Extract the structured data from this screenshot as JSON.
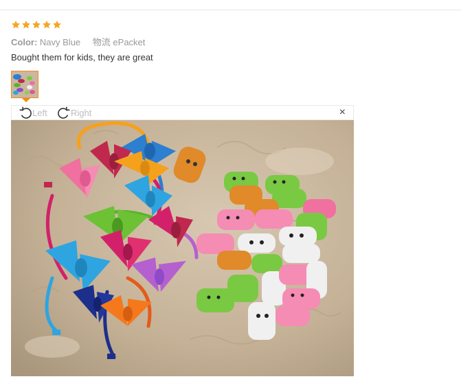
{
  "review": {
    "rating": 5,
    "rating_max": 5,
    "star_color": "#f5a623",
    "color_label": "Color:",
    "color_value": "Navy Blue",
    "shipping_label": "物流",
    "shipping_value": "ePacket",
    "comment": "Bought them for kids, they are great"
  },
  "viewer": {
    "rotate_left_label": "Left",
    "rotate_right_label": "Right",
    "close_label": "×",
    "accent_color": "#f08c1b"
  }
}
